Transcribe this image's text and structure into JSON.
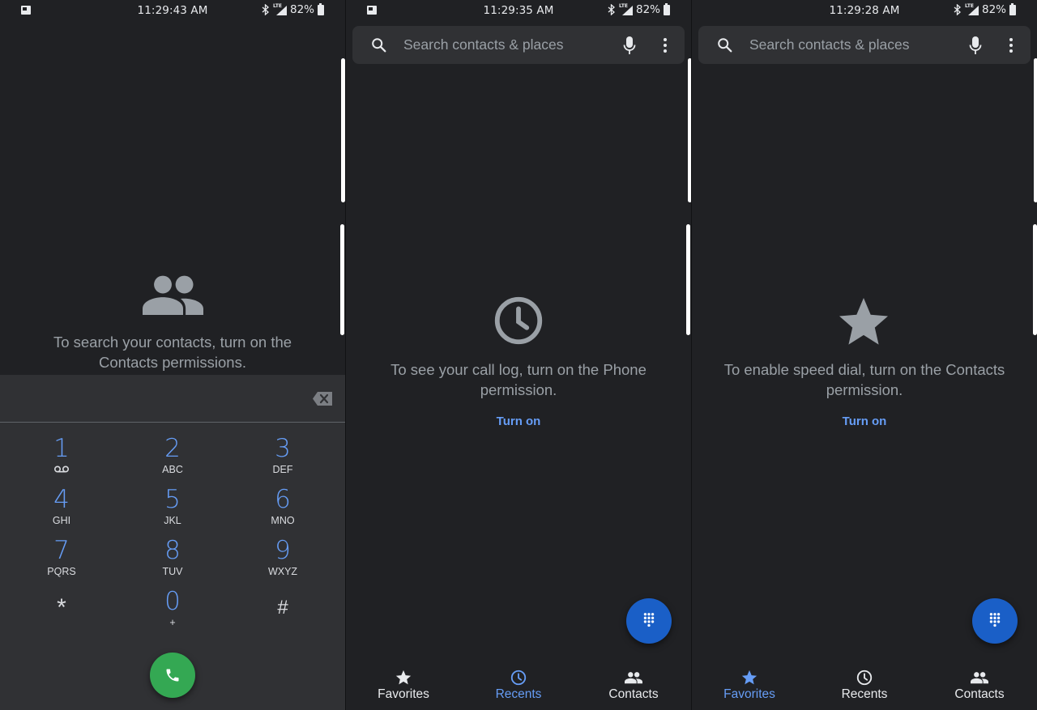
{
  "colors": {
    "background": "#202124",
    "surface": "#303134",
    "accent_blue": "#669df6",
    "fab_blue": "#1a5fc7",
    "call_green": "#34a853",
    "text_secondary": "#9aa0a6"
  },
  "panels": [
    {
      "id": "dialpad",
      "status": {
        "time": "11:29:43 AM",
        "battery": "82%",
        "network": "LTE"
      },
      "empty_state": {
        "icon": "people-icon",
        "text": "To search your contacts, turn on the Contacts permissions."
      },
      "dialpad": {
        "input_value": "",
        "keys": [
          {
            "digit": "1",
            "letters": "",
            "icon": "voicemail-icon"
          },
          {
            "digit": "2",
            "letters": "ABC"
          },
          {
            "digit": "3",
            "letters": "DEF"
          },
          {
            "digit": "4",
            "letters": "GHI"
          },
          {
            "digit": "5",
            "letters": "JKL"
          },
          {
            "digit": "6",
            "letters": "MNO"
          },
          {
            "digit": "7",
            "letters": "PQRS"
          },
          {
            "digit": "8",
            "letters": "TUV"
          },
          {
            "digit": "9",
            "letters": "WXYZ"
          },
          {
            "digit": "*",
            "letters": ""
          },
          {
            "digit": "0",
            "letters": "+"
          },
          {
            "digit": "#",
            "letters": ""
          }
        ],
        "backspace_icon": "backspace-icon",
        "call_icon": "phone-icon"
      }
    },
    {
      "id": "recents",
      "status": {
        "time": "11:29:35 AM",
        "battery": "82%",
        "network": "LTE"
      },
      "search": {
        "placeholder": "Search contacts & places"
      },
      "empty_state": {
        "icon": "clock-icon",
        "text": "To see your call log, turn on the Phone permission.",
        "action": "Turn on"
      },
      "fab_icon": "dialpad-icon",
      "nav": [
        {
          "label": "Favorites",
          "icon": "star-icon",
          "active": false
        },
        {
          "label": "Recents",
          "icon": "clock-icon",
          "active": true
        },
        {
          "label": "Contacts",
          "icon": "people-icon",
          "active": false
        }
      ]
    },
    {
      "id": "favorites",
      "status": {
        "time": "11:29:28 AM",
        "battery": "82%",
        "network": "LTE"
      },
      "search": {
        "placeholder": "Search contacts & places"
      },
      "empty_state": {
        "icon": "star-icon",
        "text": "To enable speed dial, turn on the Contacts permission.",
        "action": "Turn on"
      },
      "fab_icon": "dialpad-icon",
      "nav": [
        {
          "label": "Favorites",
          "icon": "star-icon",
          "active": true
        },
        {
          "label": "Recents",
          "icon": "clock-icon",
          "active": false
        },
        {
          "label": "Contacts",
          "icon": "people-icon",
          "active": false
        }
      ]
    }
  ]
}
